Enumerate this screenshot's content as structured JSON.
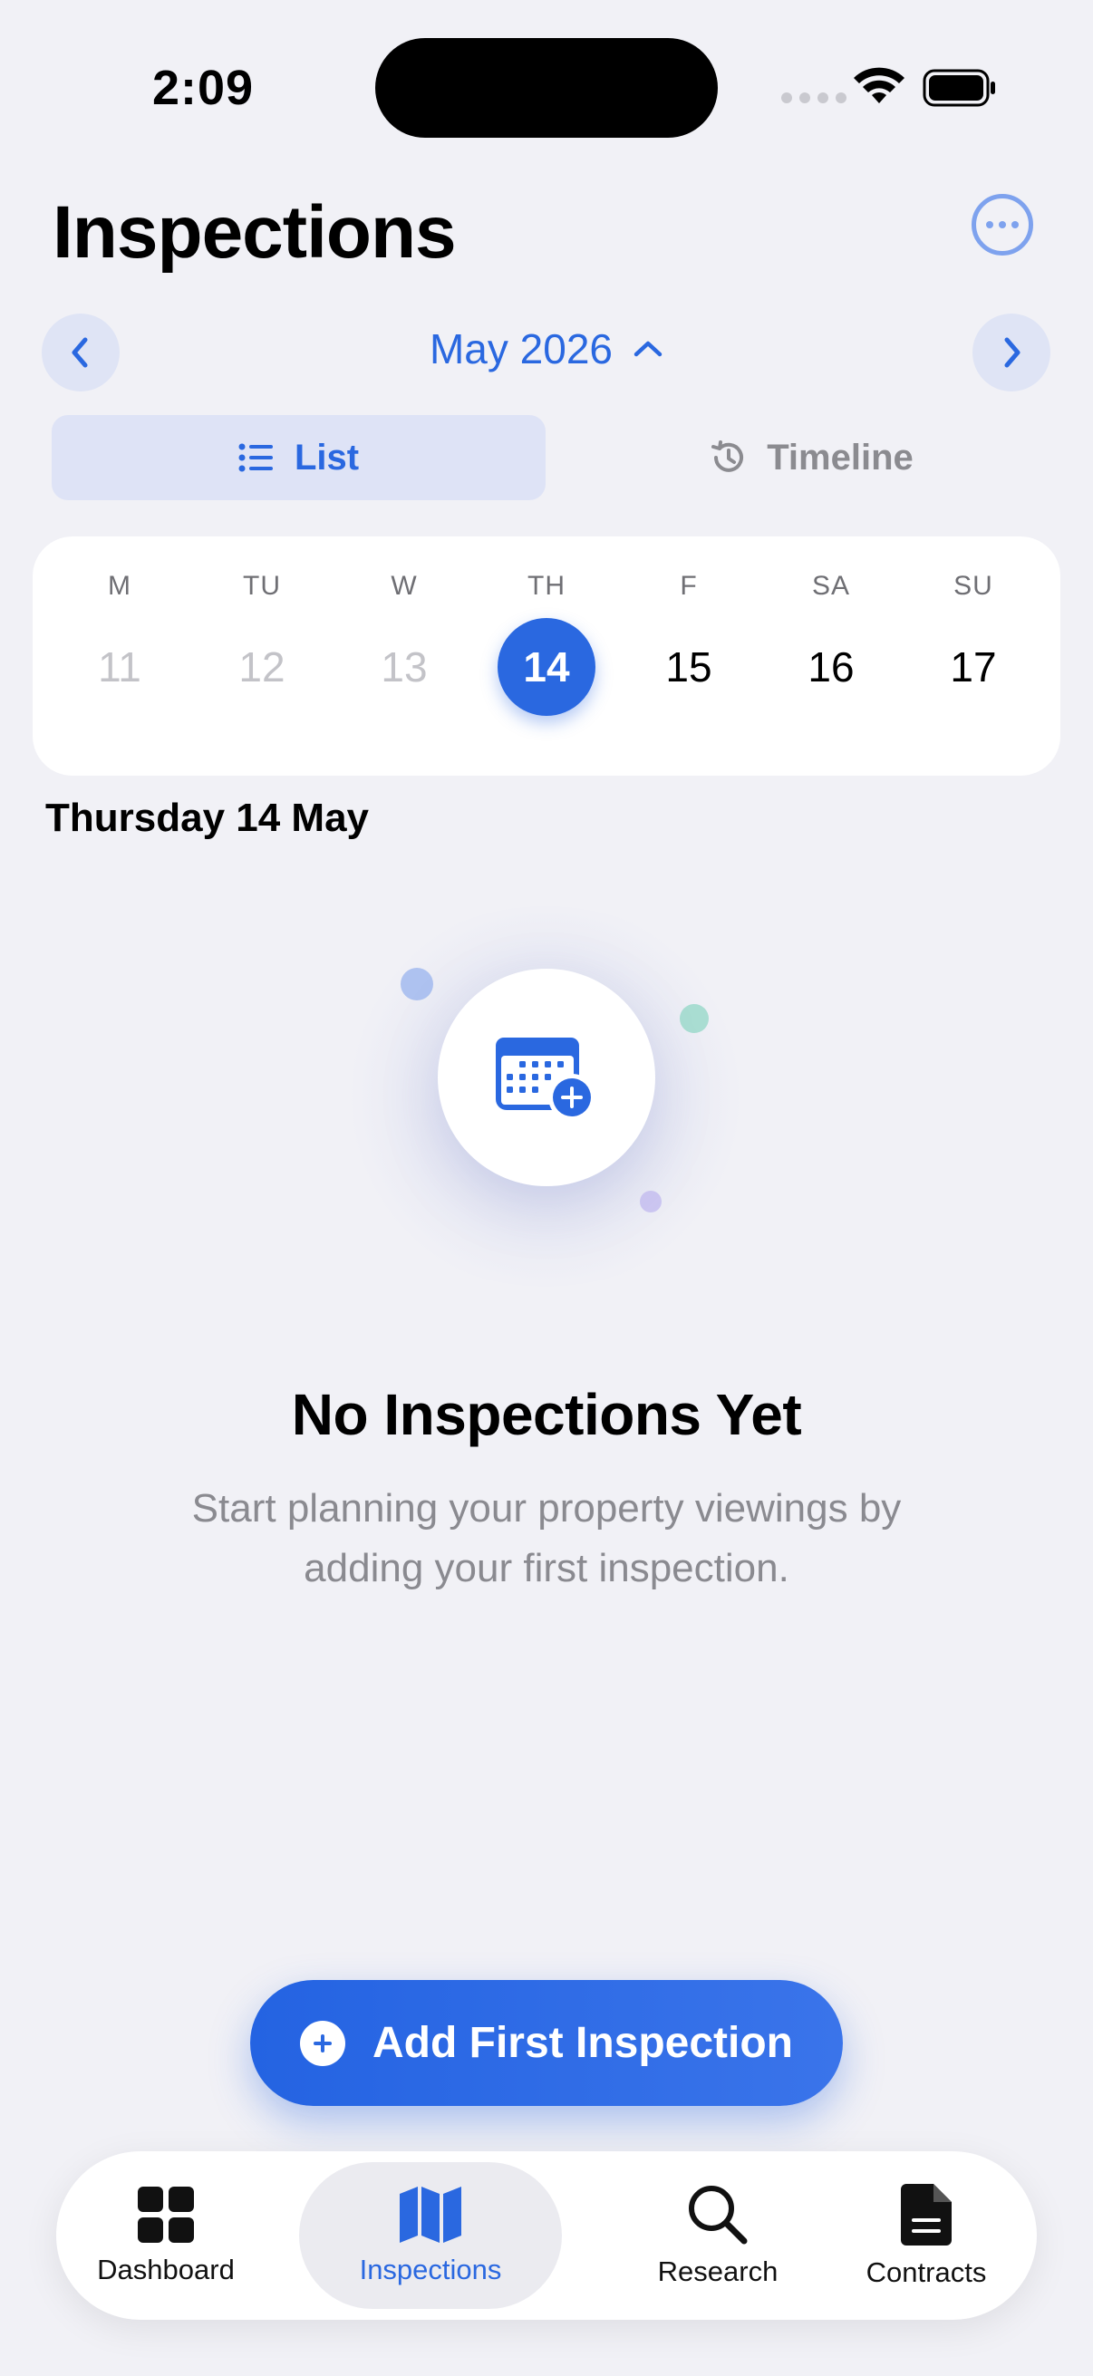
{
  "status_bar": {
    "time": "2:09"
  },
  "header": {
    "title": "Inspections",
    "more_icon": "ellipsis-circle-icon"
  },
  "month_nav": {
    "label": "May 2026",
    "prev_icon": "chevron-left-icon",
    "next_icon": "chevron-right-icon",
    "toggle_icon": "chevron-up-icon"
  },
  "view_toggle": {
    "list_label": "List",
    "timeline_label": "Timeline",
    "selected": "List"
  },
  "week": {
    "days": [
      {
        "letter": "M",
        "num": "11",
        "state": "past"
      },
      {
        "letter": "TU",
        "num": "12",
        "state": "past"
      },
      {
        "letter": "W",
        "num": "13",
        "state": "past"
      },
      {
        "letter": "TH",
        "num": "14",
        "state": "selected"
      },
      {
        "letter": "F",
        "num": "15",
        "state": "future"
      },
      {
        "letter": "SA",
        "num": "16",
        "state": "future"
      },
      {
        "letter": "SU",
        "num": "17",
        "state": "future"
      }
    ]
  },
  "selected_date_heading": "Thursday 14 May",
  "empty_state": {
    "icon": "calendar-add-icon",
    "title": "No Inspections Yet",
    "subtitle": "Start planning your property viewings by adding your first inspection."
  },
  "cta": {
    "label": "Add First Inspection",
    "icon": "plus-circle-icon"
  },
  "tabbar": {
    "items": [
      {
        "label": "Dashboard",
        "icon": "grid-icon"
      },
      {
        "label": "Inspections",
        "icon": "map-icon"
      },
      {
        "label": "Research",
        "icon": "magnifier-icon"
      },
      {
        "label": "Contracts",
        "icon": "document-icon"
      }
    ],
    "active": "Inspections"
  },
  "colors": {
    "accent": "#2a68e0",
    "background": "#f1f1f6",
    "muted": "#8a8a90"
  }
}
